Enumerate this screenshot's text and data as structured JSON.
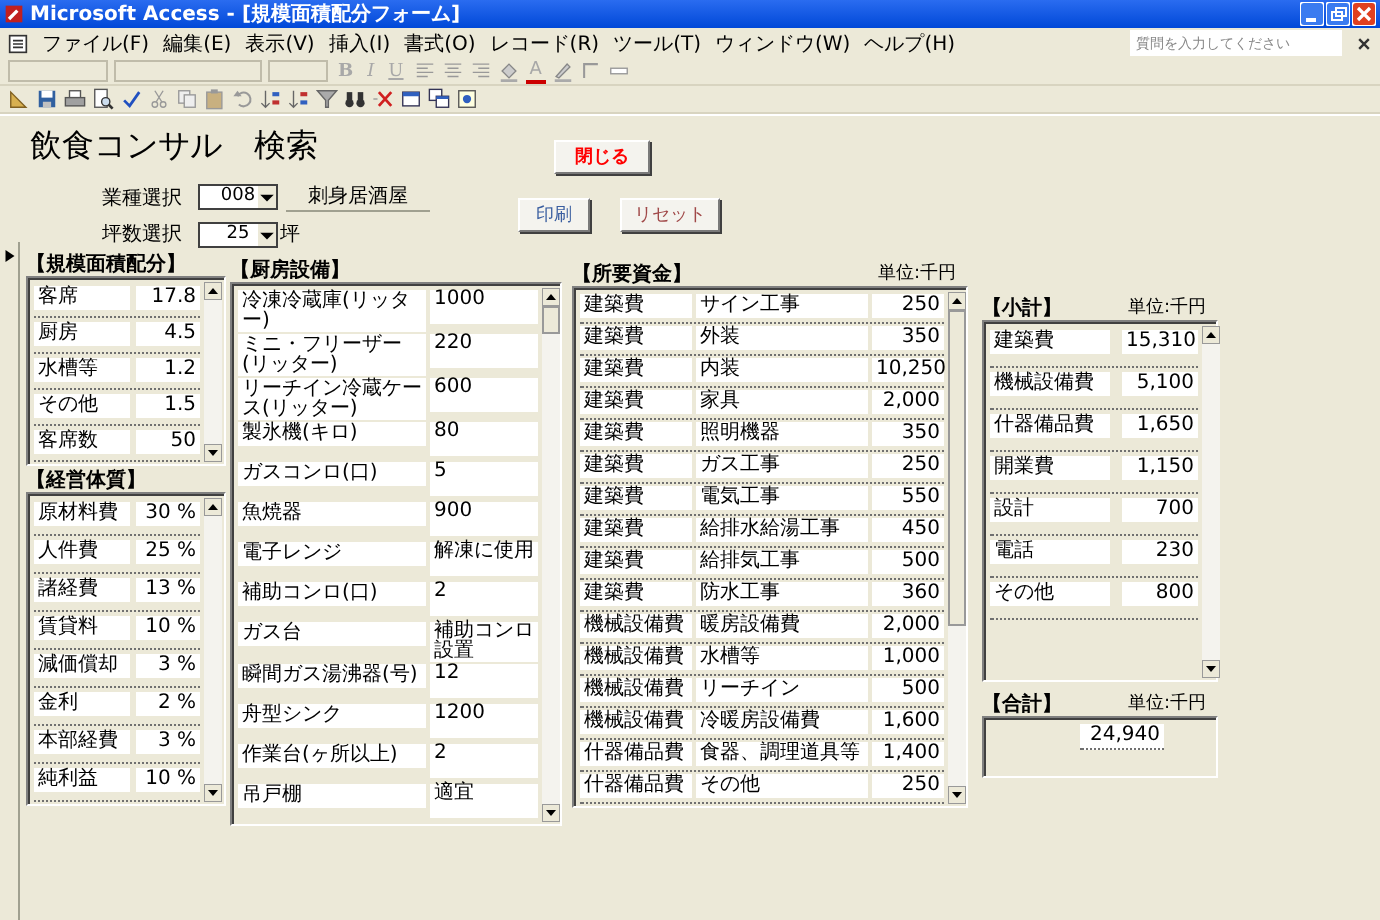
{
  "window": {
    "title": "Microsoft Access - [規模面積配分フォーム]"
  },
  "menu": [
    "ファイル(F)",
    "編集(E)",
    "表示(V)",
    "挿入(I)",
    "書式(O)",
    "レコード(R)",
    "ツール(T)",
    "ウィンドウ(W)",
    "ヘルプ(H)"
  ],
  "help_box": {
    "placeholder": "質問を入力してください"
  },
  "format_toolbar": {
    "buttons": [
      {
        "label": "B",
        "disabled": true
      },
      {
        "label": "I",
        "disabled": true
      },
      {
        "label": "U",
        "disabled": true
      }
    ],
    "font_color": "A"
  },
  "form": {
    "title": "飲食コンサル　検索",
    "close_button": "閉じる",
    "industry": {
      "label": "業種選択",
      "value": "008",
      "name": "刺身居酒屋"
    },
    "tsubo": {
      "label": "坪数選択",
      "value": "25",
      "unit": "坪"
    },
    "print_button": "印刷",
    "reset_button": "リセット"
  },
  "area": {
    "title": "【規模面積配分】",
    "rows": [
      {
        "label": "客席",
        "value": "17.8"
      },
      {
        "label": "厨房",
        "value": "4.5"
      },
      {
        "label": "水槽等",
        "value": "1.2"
      },
      {
        "label": "その他",
        "value": "1.5"
      },
      {
        "label": "客席数",
        "value": "50"
      }
    ]
  },
  "management": {
    "title": "【経営体質】",
    "rows": [
      {
        "label": "原材料費",
        "value": "30 %"
      },
      {
        "label": "人件費",
        "value": "25 %"
      },
      {
        "label": "諸経費",
        "value": "13 %"
      },
      {
        "label": "賃貸料",
        "value": "10 %"
      },
      {
        "label": "減価償却",
        "value": "3 %"
      },
      {
        "label": "金利",
        "value": "2 %"
      },
      {
        "label": "本部経費",
        "value": "3 %"
      },
      {
        "label": "純利益",
        "value": "10 %"
      }
    ]
  },
  "kitchen": {
    "title": "【厨房設備】",
    "rows": [
      {
        "label": "冷凍冷蔵庫(リッター)",
        "value": "1000"
      },
      {
        "label": "ミニ・フリーザー(リッター)",
        "value": "220"
      },
      {
        "label": "リーチイン冷蔵ケース(リッター)",
        "value": "600"
      },
      {
        "label": "製氷機(キロ)",
        "value": "80"
      },
      {
        "label": "ガスコンロ(口)",
        "value": "5"
      },
      {
        "label": "魚焼器",
        "value": "900"
      },
      {
        "label": "電子レンジ",
        "value": "解凍に使用"
      },
      {
        "label": "補助コンロ(口)",
        "value": "2"
      },
      {
        "label": "ガス台",
        "value": "補助コンロ設置"
      },
      {
        "label": "瞬間ガス湯沸器(号)",
        "value": "12"
      },
      {
        "label": "舟型シンク",
        "value": "1200"
      },
      {
        "label": "作業台(ヶ所以上)",
        "value": "2"
      },
      {
        "label": "吊戸棚",
        "value": "適宜"
      }
    ]
  },
  "funds": {
    "title": "【所要資金】",
    "unit": "単位:千円",
    "rows": [
      {
        "category": "建築費",
        "item": "サイン工事",
        "amount": "250"
      },
      {
        "category": "建築費",
        "item": "外装",
        "amount": "350"
      },
      {
        "category": "建築費",
        "item": "内装",
        "amount": "10,250"
      },
      {
        "category": "建築費",
        "item": "家具",
        "amount": "2,000"
      },
      {
        "category": "建築費",
        "item": "照明機器",
        "amount": "350"
      },
      {
        "category": "建築費",
        "item": "ガス工事",
        "amount": "250"
      },
      {
        "category": "建築費",
        "item": "電気工事",
        "amount": "550"
      },
      {
        "category": "建築費",
        "item": "給排水給湯工事",
        "amount": "450"
      },
      {
        "category": "建築費",
        "item": "給排気工事",
        "amount": "500"
      },
      {
        "category": "建築費",
        "item": "防水工事",
        "amount": "360"
      },
      {
        "category": "機械設備費",
        "item": "暖房設備費",
        "amount": "2,000"
      },
      {
        "category": "機械設備費",
        "item": "水槽等",
        "amount": "1,000"
      },
      {
        "category": "機械設備費",
        "item": "リーチイン",
        "amount": "500"
      },
      {
        "category": "機械設備費",
        "item": "冷暖房設備費",
        "amount": "1,600"
      },
      {
        "category": "什器備品費",
        "item": "食器、調理道具等",
        "amount": "1,400"
      },
      {
        "category": "什器備品費",
        "item": "その他",
        "amount": "250"
      }
    ]
  },
  "subtotal": {
    "title": "【小計】",
    "unit": "単位:千円",
    "rows": [
      {
        "label": "建築費",
        "value": "15,310"
      },
      {
        "label": "機械設備費",
        "value": "5,100"
      },
      {
        "label": "什器備品費",
        "value": "1,650"
      },
      {
        "label": "開業費",
        "value": "1,150"
      },
      {
        "label": "設計",
        "value": "700"
      },
      {
        "label": "電話",
        "value": "230"
      },
      {
        "label": "その他",
        "value": "800"
      }
    ]
  },
  "total": {
    "title": "【合計】",
    "unit": "単位:千円",
    "value": "24,940"
  }
}
